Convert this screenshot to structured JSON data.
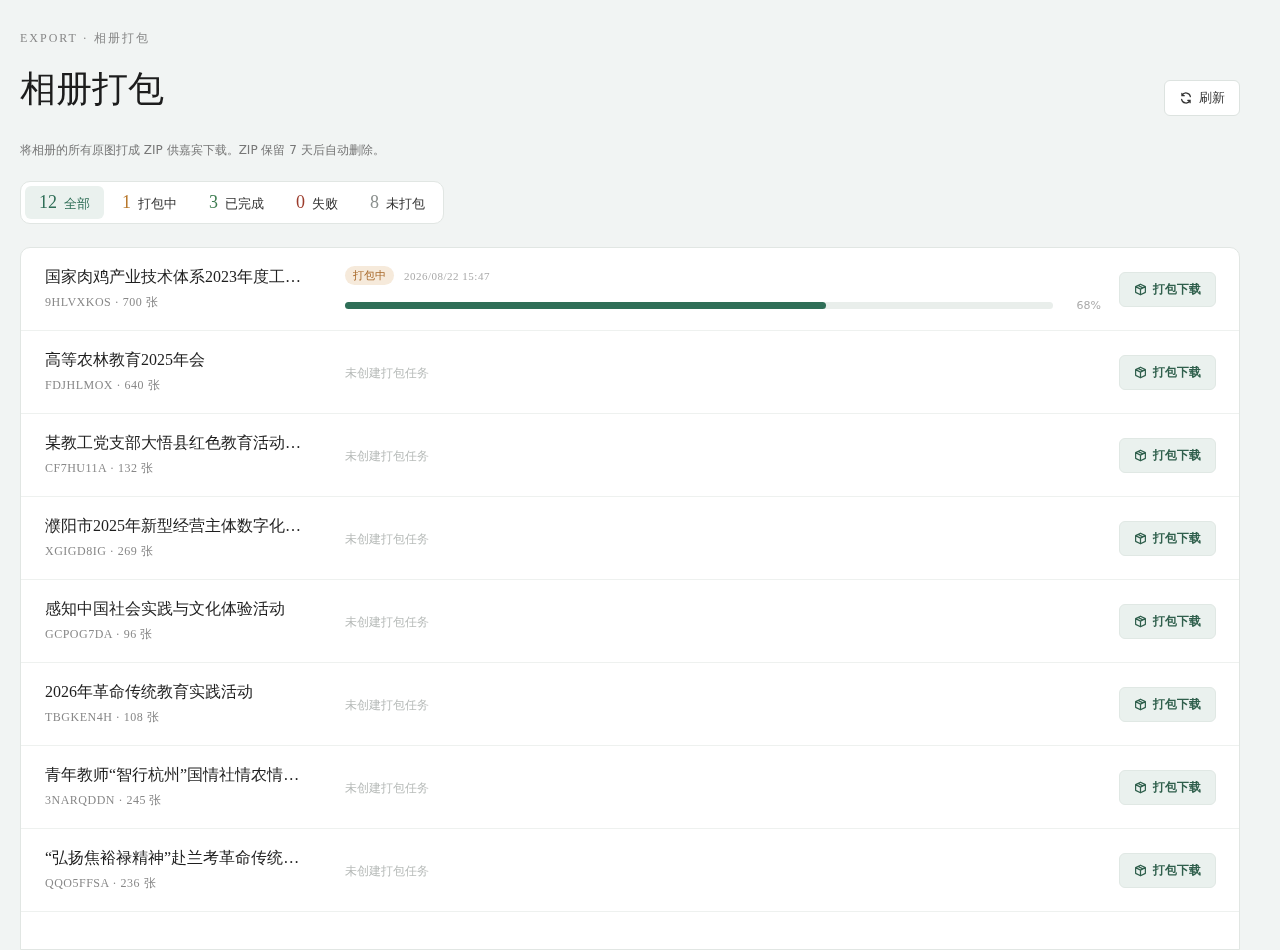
{
  "breadcrumb": "EXPORT · 相册打包",
  "title": "相册打包",
  "refresh_button": "刷新",
  "description": "将相册的所有原图打成 ZIP 供嘉宾下载。ZIP 保留 7 天后自动删除。",
  "filters": [
    {
      "count": "12",
      "label": "全部",
      "color": "#2f6e57",
      "selected": true
    },
    {
      "count": "1",
      "label": "打包中",
      "color": "#b8782c",
      "selected": false
    },
    {
      "count": "3",
      "label": "已完成",
      "color": "#3f7d52",
      "selected": false
    },
    {
      "count": "0",
      "label": "失败",
      "color": "#9b3b2b",
      "selected": false
    },
    {
      "count": "8",
      "label": "未打包",
      "color": "#8a8f8d",
      "selected": false
    }
  ],
  "albums": [
    {
      "title": "国家肉鸡产业技术体系2023年度工…",
      "meta": "9HLVXKOS · 700 张",
      "kind": "packing",
      "badge": "打包中",
      "time": "2026/08/22 15:47",
      "level": 0.68,
      "percent": "68%",
      "button": "打包下载"
    },
    {
      "title": "高等农林教育2025年会",
      "meta": "FDJHLMOX · 640 张",
      "kind": "none",
      "note": "未创建打包任务",
      "button": "打包下载"
    },
    {
      "title": "某教工党支部大悟县红色教育活动…",
      "meta": "CF7HU11A · 132 张",
      "kind": "none",
      "note": "未创建打包任务",
      "button": "打包下载"
    },
    {
      "title": "濮阳市2025年新型经营主体数字化…",
      "meta": "XGIGD8IG · 269 张",
      "kind": "none",
      "note": "未创建打包任务",
      "button": "打包下载"
    },
    {
      "title": "感知中国社会实践与文化体验活动",
      "meta": "GCPOG7DA · 96 张",
      "kind": "none",
      "note": "未创建打包任务",
      "button": "打包下载"
    },
    {
      "title": "2026年革命传统教育实践活动",
      "meta": "TBGKEN4H · 108 张",
      "kind": "none",
      "note": "未创建打包任务",
      "button": "打包下载"
    },
    {
      "title": "青年教师“智行杭州”国情社情农情…",
      "meta": "3NARQDDN · 245 张",
      "kind": "none",
      "note": "未创建打包任务",
      "button": "打包下载"
    },
    {
      "title": "“弘扬焦裕禄精神”赴兰考革命传统…",
      "meta": "QQO5FFSA · 236 张",
      "kind": "none",
      "note": "未创建打包任务",
      "button": "打包下载"
    }
  ]
}
